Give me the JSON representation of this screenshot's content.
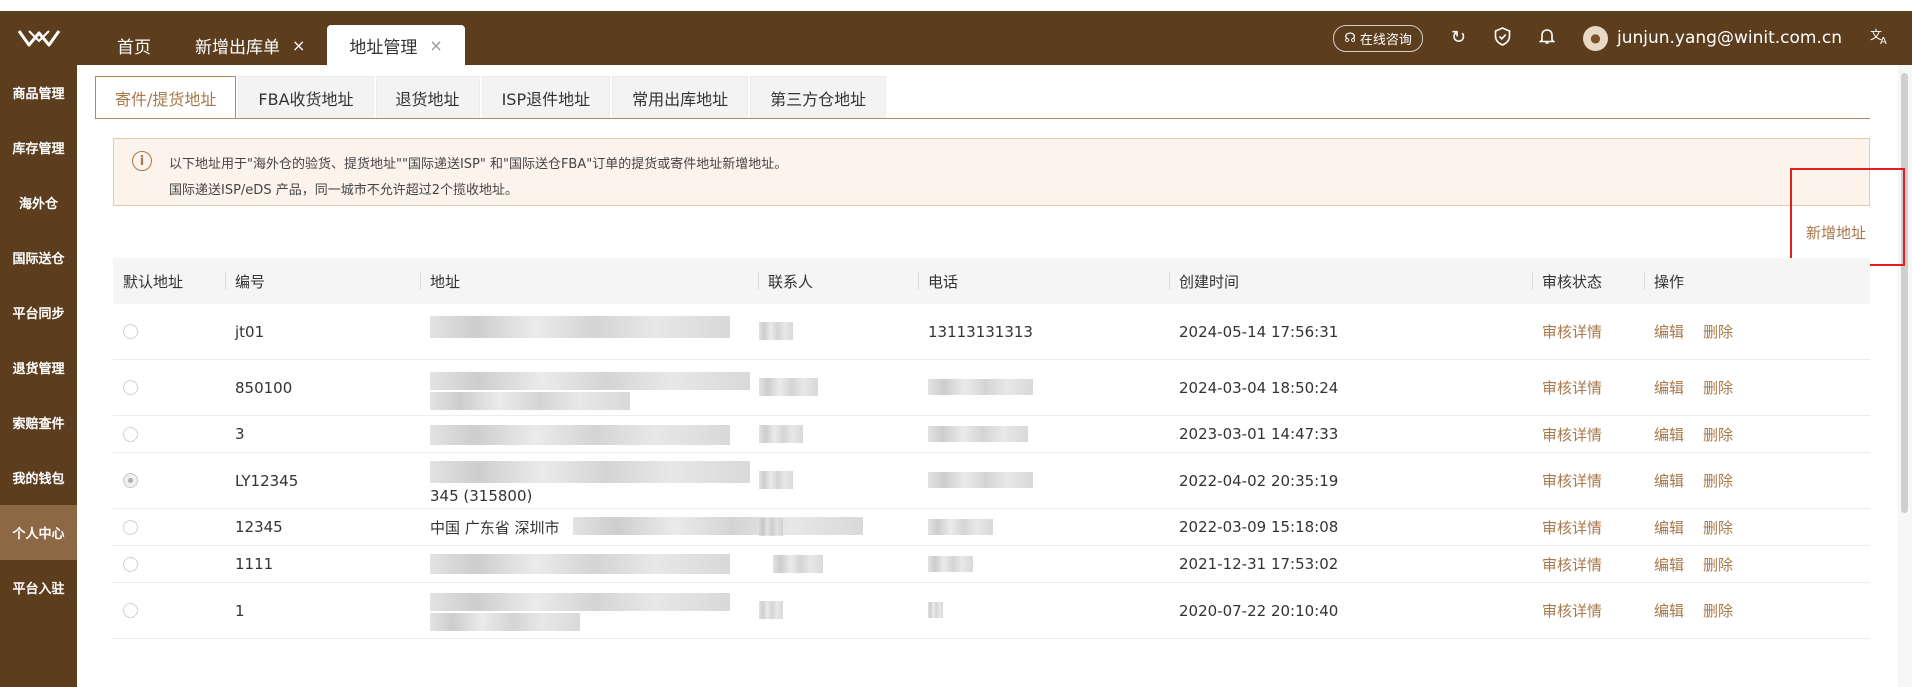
{
  "header": {
    "logo_icon": "winit-logo-icon",
    "tabs": [
      {
        "label": "首页",
        "closable": false,
        "active": false
      },
      {
        "label": "新增出库单",
        "closable": true,
        "active": false
      },
      {
        "label": "地址管理",
        "closable": true,
        "active": true
      }
    ],
    "close_glyph": "×",
    "consult_label": "在线咨询",
    "user_email": "junjun.yang@winit.com.cn"
  },
  "sidebar": {
    "items": [
      "商品管理",
      "库存管理",
      "海外仓",
      "国际送仓",
      "平台同步",
      "退货管理",
      "索赔查件",
      "我的钱包",
      "个人中心",
      "平台入驻"
    ],
    "active_index": 8
  },
  "subtabs": {
    "items": [
      "寄件/提货地址",
      "FBA收货地址",
      "退货地址",
      "ISP退件地址",
      "常用出库地址",
      "第三方仓地址"
    ],
    "active_index": 0
  },
  "notice": {
    "icon": "info-icon",
    "line1": "以下地址用于\"海外仓的验货、提货地址\"\"国际递送ISP\" 和\"国际送仓FBA\"订单的提货或寄件地址新增地址。",
    "line2": "国际递送ISP/eDS 产品，同一城市不允许超过2个揽收地址。"
  },
  "add_address_label": "新增地址",
  "table": {
    "headers": [
      "默认地址",
      "编号",
      "地址",
      "联系人",
      "电话",
      "创建时间",
      "审核状态",
      "操作"
    ],
    "review_label": "审核详情",
    "edit_label": "编辑",
    "delete_label": "删除",
    "rows": [
      {
        "default": false,
        "code": "jt01",
        "address_visible": "",
        "phone": "13113131313",
        "created": "2024-05-14 17:56:31"
      },
      {
        "default": false,
        "code": "850100",
        "address_visible": "",
        "phone": "",
        "created": "2024-03-04 18:50:24"
      },
      {
        "default": false,
        "code": "3",
        "address_visible": "",
        "phone": "",
        "created": "2023-03-01 14:47:33"
      },
      {
        "default": true,
        "code": "LY12345",
        "address_visible": "345 (315800)",
        "phone": "",
        "created": "2022-04-02 20:35:19"
      },
      {
        "default": false,
        "code": "12345",
        "address_visible": "中国 广东省 深圳市",
        "phone": "",
        "created": "2022-03-09 15:18:08"
      },
      {
        "default": false,
        "code": "1111",
        "address_visible": "",
        "phone": "",
        "created": "2021-12-31 17:53:02"
      },
      {
        "default": false,
        "code": "1",
        "address_visible": "",
        "phone": "",
        "created": "2020-07-22 20:10:40"
      }
    ]
  }
}
